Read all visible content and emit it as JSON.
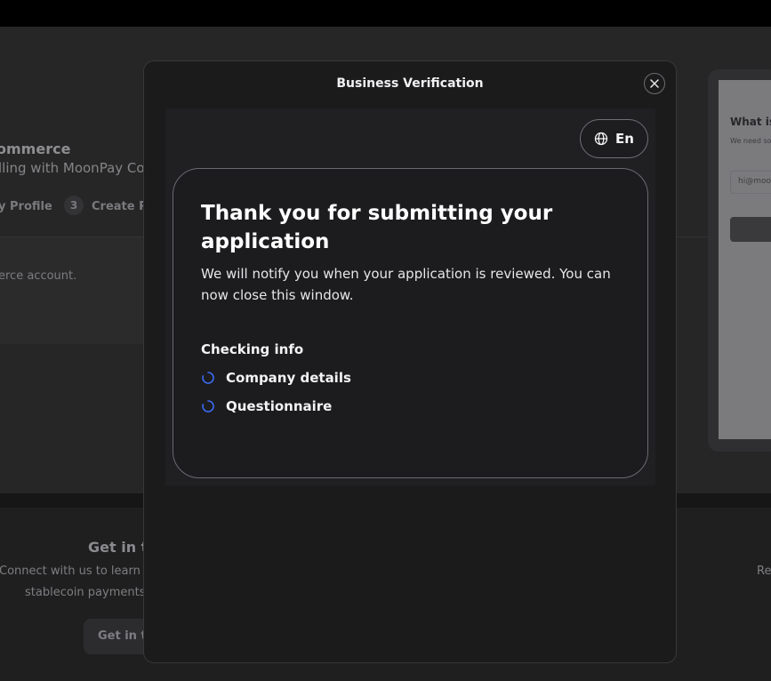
{
  "background": {
    "title": "ommerce",
    "subtitle": "lling with MoonPay Con",
    "steps": [
      {
        "label": "y Profile"
      },
      {
        "number": "3",
        "label": "Create Pa"
      }
    ],
    "body_text": "erce account.",
    "right_panel": {
      "question": "What is y",
      "small_text": "We need so",
      "input_value": "hi@moon"
    },
    "contact": {
      "title": "Get in to",
      "line1": "Connect with us to learn al",
      "line2": "stablecoin payments",
      "button_label": "Get in to",
      "right_text": "Re"
    }
  },
  "modal": {
    "title": "Business Verification",
    "close_icon": "close-icon",
    "language": {
      "icon": "globe-icon",
      "label": "En"
    },
    "card": {
      "heading": "Thank you for submitting your application",
      "body": "We will notify you when your application is reviewed. You can now close this window.",
      "checking_label": "Checking info",
      "items": [
        {
          "label": "Company details",
          "icon": "loading-spinner-icon"
        },
        {
          "label": "Questionnaire",
          "icon": "loading-spinner-icon"
        }
      ]
    },
    "colors": {
      "spinner": "#3b6cf6"
    }
  }
}
